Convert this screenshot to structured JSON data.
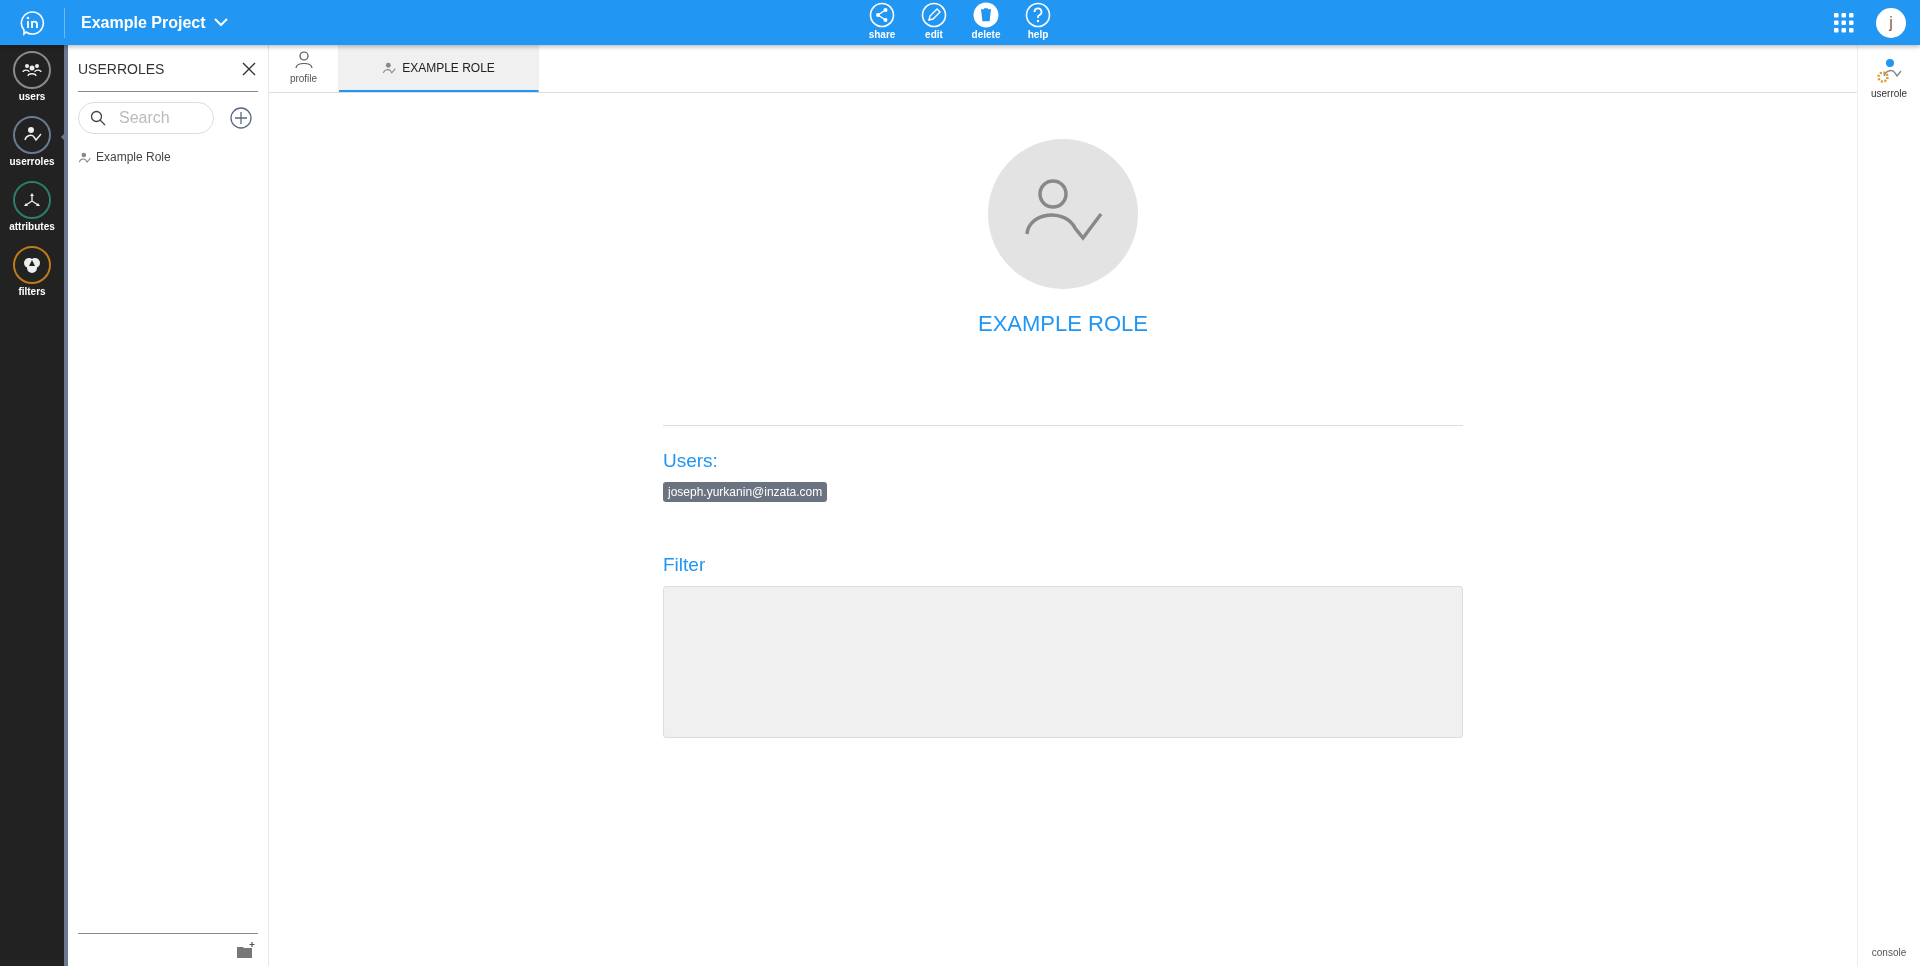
{
  "header": {
    "project": "Example Project",
    "actions": [
      {
        "kind": "share",
        "label": "share"
      },
      {
        "kind": "edit",
        "label": "edit"
      },
      {
        "kind": "delete",
        "label": "delete"
      },
      {
        "kind": "help",
        "label": "help"
      }
    ],
    "avatar": "j"
  },
  "nav": [
    {
      "kind": "users",
      "label": "users",
      "color": "#8a8a8a",
      "selected": false
    },
    {
      "kind": "userroles",
      "label": "userroles",
      "color": "#6b7a90",
      "selected": true
    },
    {
      "kind": "attributes",
      "label": "attributes",
      "color": "#2e7d6b",
      "selected": false
    },
    {
      "kind": "filters",
      "label": "filters",
      "color": "#c07a1a",
      "selected": false
    }
  ],
  "panel": {
    "title": "USERROLES",
    "search": {
      "placeholder": "Search"
    },
    "items": [
      {
        "label": "Example Role",
        "selected": false
      }
    ]
  },
  "tabs": [
    {
      "kind": "profile",
      "label": "profile",
      "selected": false
    },
    {
      "kind": "role",
      "label": "EXAMPLE ROLE",
      "selected": true
    }
  ],
  "role": {
    "name": "EXAMPLE ROLE",
    "users_heading": "Users:",
    "users": [
      "joseph.yurkanin@inzata.com"
    ],
    "filter_heading": "Filter"
  },
  "right_rail": {
    "item": "userrole",
    "footer": "console"
  }
}
